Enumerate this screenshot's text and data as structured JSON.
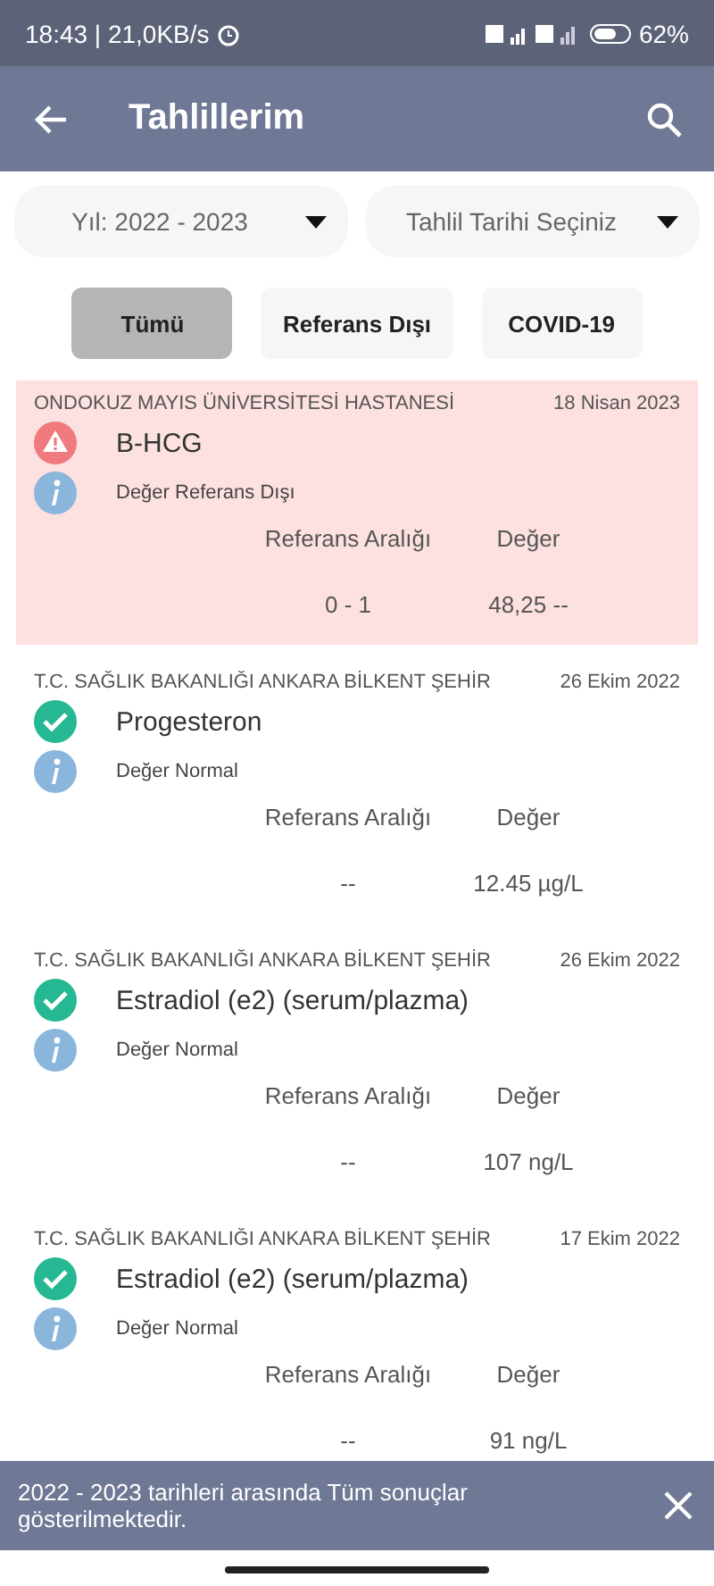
{
  "status_bar": {
    "time": "18:43 | 21,0KB/s",
    "battery": "62%"
  },
  "app_bar": {
    "title": "Tahlillerim"
  },
  "filters": [
    {
      "label": "Yıl: 2022 - 2023"
    },
    {
      "label": "Tahlil Tarihi Seçiniz"
    }
  ],
  "tabs": [
    {
      "label": "Tümü",
      "selected": true
    },
    {
      "label": "Referans Dışı",
      "selected": false
    },
    {
      "label": "COVID-19",
      "selected": false
    }
  ],
  "results": [
    {
      "hospital": "ONDOKUZ MAYIS ÜNİVERSİTESİ HASTANESİ",
      "date": "18 Nisan 2023",
      "test": "B-HCG",
      "kind": "abnormal",
      "status": "Değer Referans Dışı",
      "range_label": "Referans Aralığı",
      "value_label": "Değer",
      "range": "0 - 1",
      "value": "48,25 --"
    },
    {
      "hospital": "T.C. SAĞLIK BAKANLIĞI ANKARA BİLKENT ŞEHİR",
      "date": "26 Ekim 2022",
      "test": "Progesteron",
      "kind": "normal",
      "status": "Değer Normal",
      "range_label": "Referans Aralığı",
      "value_label": "Değer",
      "range": "--",
      "value": "12.45 µg/L"
    },
    {
      "hospital": "T.C. SAĞLIK BAKANLIĞI ANKARA BİLKENT ŞEHİR",
      "date": "26 Ekim 2022",
      "test": "Estradiol (e2) (serum/plazma)",
      "kind": "normal",
      "status": "Değer Normal",
      "range_label": "Referans Aralığı",
      "value_label": "Değer",
      "range": "--",
      "value": "107 ng/L"
    },
    {
      "hospital": "T.C. SAĞLIK BAKANLIĞI ANKARA BİLKENT ŞEHİR",
      "date": "17 Ekim 2022",
      "test": "Estradiol (e2) (serum/plazma)",
      "kind": "normal",
      "status": "Değer Normal",
      "range_label": "Referans Aralığı",
      "value_label": "Değer",
      "range": "--",
      "value": "91 ng/L"
    }
  ],
  "snackbar": {
    "message": "2022 - 2023 tarihleri arasında Tüm sonuçlar gösterilmektedir."
  }
}
